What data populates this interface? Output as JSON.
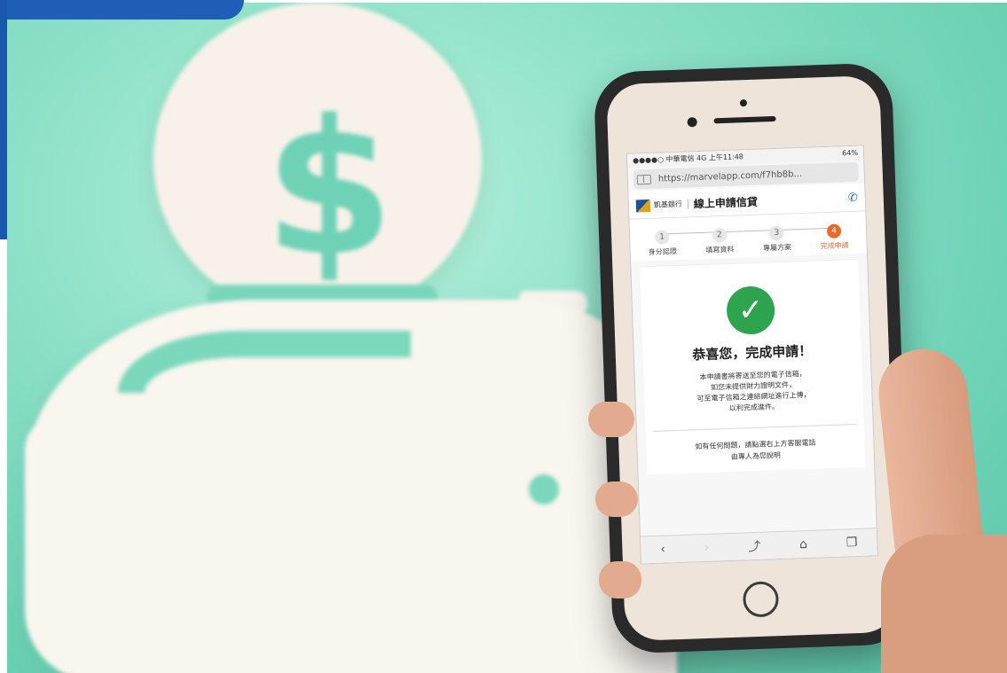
{
  "phone": {
    "status_left": "●●●●○ 中華電信  4G   上午11:48",
    "status_right": "64%",
    "url": "https://marvelapp.com/f7hb8b...",
    "bank_name": "凱基銀行",
    "page_title": "線上申請信貸",
    "steps": [
      {
        "num": "1",
        "label": "身分認證"
      },
      {
        "num": "2",
        "label": "填寫資料"
      },
      {
        "num": "3",
        "label": "專屬方案"
      },
      {
        "num": "4",
        "label": "完成申請"
      }
    ],
    "success_title": "恭喜您，完成申請！",
    "message_lines": [
      "本申請書將寄送至您的電子信箱，",
      "如您未提供財力證明文件，",
      "可至電子信箱之連結網址進行上傳，",
      "以利完成進件。"
    ],
    "help_lines": [
      "如有任何問題，請點選右上方客服電話",
      "由專人為您說明"
    ]
  },
  "scene": {
    "dollar_symbol": "$",
    "check_symbol": "✓"
  },
  "colors": {
    "background": "#8fe2c9",
    "accent_orange": "#e86a2c",
    "success_green": "#2fa44f",
    "brand_blue": "#1f5fb8"
  }
}
